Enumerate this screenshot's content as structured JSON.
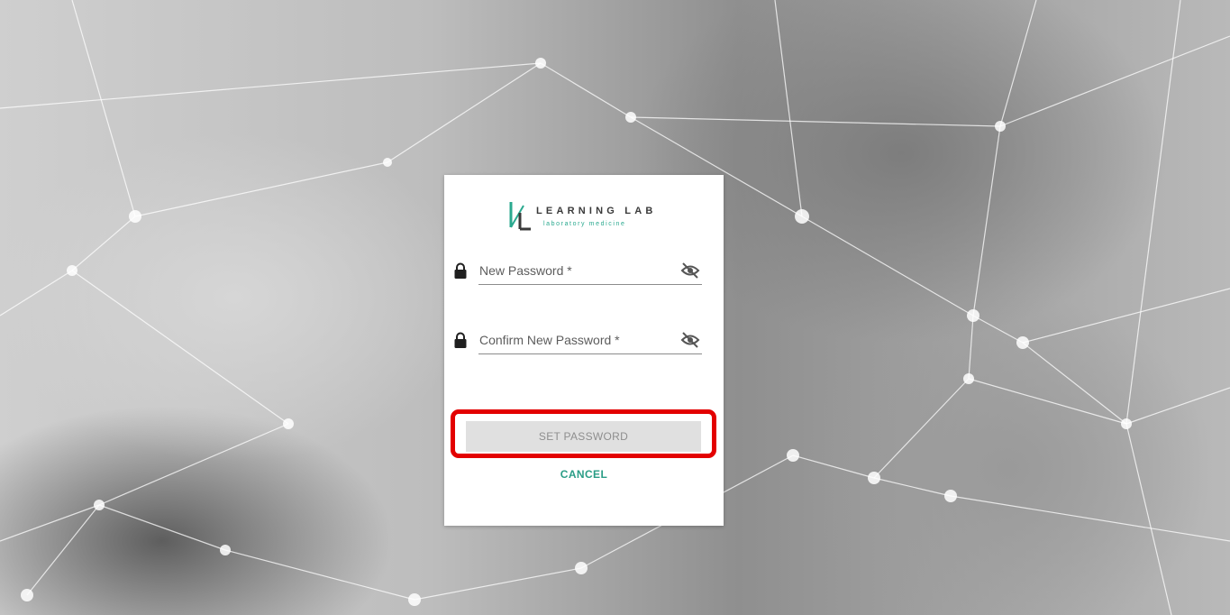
{
  "logo": {
    "title": "LEARNING LAB",
    "subtitle": "laboratory medicine"
  },
  "form": {
    "new_password": {
      "label": "New Password *",
      "value": "",
      "icon_left": "lock-icon",
      "icon_right": "eye-off-icon"
    },
    "confirm_password": {
      "label": "Confirm New Password *",
      "value": "",
      "icon_left": "lock-icon",
      "icon_right": "eye-off-icon"
    },
    "set_password_label": "SET PASSWORD",
    "cancel_label": "CANCEL"
  },
  "colors": {
    "accent": "#2a9d86",
    "highlight": "#e30000",
    "button_disabled_bg": "#e0e0e0",
    "button_disabled_text": "#8e8e8e"
  }
}
